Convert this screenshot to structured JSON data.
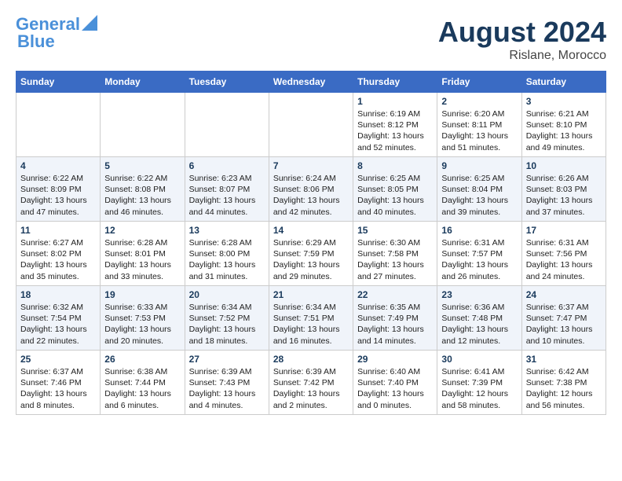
{
  "header": {
    "logo_line1": "General",
    "logo_line2": "Blue",
    "main_title": "August 2024",
    "subtitle": "Rislane, Morocco"
  },
  "calendar": {
    "days_of_week": [
      "Sunday",
      "Monday",
      "Tuesday",
      "Wednesday",
      "Thursday",
      "Friday",
      "Saturday"
    ],
    "weeks": [
      [
        {
          "day": "",
          "content": ""
        },
        {
          "day": "",
          "content": ""
        },
        {
          "day": "",
          "content": ""
        },
        {
          "day": "",
          "content": ""
        },
        {
          "day": "1",
          "content": "Sunrise: 6:19 AM\nSunset: 8:12 PM\nDaylight: 13 hours\nand 52 minutes."
        },
        {
          "day": "2",
          "content": "Sunrise: 6:20 AM\nSunset: 8:11 PM\nDaylight: 13 hours\nand 51 minutes."
        },
        {
          "day": "3",
          "content": "Sunrise: 6:21 AM\nSunset: 8:10 PM\nDaylight: 13 hours\nand 49 minutes."
        }
      ],
      [
        {
          "day": "4",
          "content": "Sunrise: 6:22 AM\nSunset: 8:09 PM\nDaylight: 13 hours\nand 47 minutes."
        },
        {
          "day": "5",
          "content": "Sunrise: 6:22 AM\nSunset: 8:08 PM\nDaylight: 13 hours\nand 46 minutes."
        },
        {
          "day": "6",
          "content": "Sunrise: 6:23 AM\nSunset: 8:07 PM\nDaylight: 13 hours\nand 44 minutes."
        },
        {
          "day": "7",
          "content": "Sunrise: 6:24 AM\nSunset: 8:06 PM\nDaylight: 13 hours\nand 42 minutes."
        },
        {
          "day": "8",
          "content": "Sunrise: 6:25 AM\nSunset: 8:05 PM\nDaylight: 13 hours\nand 40 minutes."
        },
        {
          "day": "9",
          "content": "Sunrise: 6:25 AM\nSunset: 8:04 PM\nDaylight: 13 hours\nand 39 minutes."
        },
        {
          "day": "10",
          "content": "Sunrise: 6:26 AM\nSunset: 8:03 PM\nDaylight: 13 hours\nand 37 minutes."
        }
      ],
      [
        {
          "day": "11",
          "content": "Sunrise: 6:27 AM\nSunset: 8:02 PM\nDaylight: 13 hours\nand 35 minutes."
        },
        {
          "day": "12",
          "content": "Sunrise: 6:28 AM\nSunset: 8:01 PM\nDaylight: 13 hours\nand 33 minutes."
        },
        {
          "day": "13",
          "content": "Sunrise: 6:28 AM\nSunset: 8:00 PM\nDaylight: 13 hours\nand 31 minutes."
        },
        {
          "day": "14",
          "content": "Sunrise: 6:29 AM\nSunset: 7:59 PM\nDaylight: 13 hours\nand 29 minutes."
        },
        {
          "day": "15",
          "content": "Sunrise: 6:30 AM\nSunset: 7:58 PM\nDaylight: 13 hours\nand 27 minutes."
        },
        {
          "day": "16",
          "content": "Sunrise: 6:31 AM\nSunset: 7:57 PM\nDaylight: 13 hours\nand 26 minutes."
        },
        {
          "day": "17",
          "content": "Sunrise: 6:31 AM\nSunset: 7:56 PM\nDaylight: 13 hours\nand 24 minutes."
        }
      ],
      [
        {
          "day": "18",
          "content": "Sunrise: 6:32 AM\nSunset: 7:54 PM\nDaylight: 13 hours\nand 22 minutes."
        },
        {
          "day": "19",
          "content": "Sunrise: 6:33 AM\nSunset: 7:53 PM\nDaylight: 13 hours\nand 20 minutes."
        },
        {
          "day": "20",
          "content": "Sunrise: 6:34 AM\nSunset: 7:52 PM\nDaylight: 13 hours\nand 18 minutes."
        },
        {
          "day": "21",
          "content": "Sunrise: 6:34 AM\nSunset: 7:51 PM\nDaylight: 13 hours\nand 16 minutes."
        },
        {
          "day": "22",
          "content": "Sunrise: 6:35 AM\nSunset: 7:49 PM\nDaylight: 13 hours\nand 14 minutes."
        },
        {
          "day": "23",
          "content": "Sunrise: 6:36 AM\nSunset: 7:48 PM\nDaylight: 13 hours\nand 12 minutes."
        },
        {
          "day": "24",
          "content": "Sunrise: 6:37 AM\nSunset: 7:47 PM\nDaylight: 13 hours\nand 10 minutes."
        }
      ],
      [
        {
          "day": "25",
          "content": "Sunrise: 6:37 AM\nSunset: 7:46 PM\nDaylight: 13 hours\nand 8 minutes."
        },
        {
          "day": "26",
          "content": "Sunrise: 6:38 AM\nSunset: 7:44 PM\nDaylight: 13 hours\nand 6 minutes."
        },
        {
          "day": "27",
          "content": "Sunrise: 6:39 AM\nSunset: 7:43 PM\nDaylight: 13 hours\nand 4 minutes."
        },
        {
          "day": "28",
          "content": "Sunrise: 6:39 AM\nSunset: 7:42 PM\nDaylight: 13 hours\nand 2 minutes."
        },
        {
          "day": "29",
          "content": "Sunrise: 6:40 AM\nSunset: 7:40 PM\nDaylight: 13 hours\nand 0 minutes."
        },
        {
          "day": "30",
          "content": "Sunrise: 6:41 AM\nSunset: 7:39 PM\nDaylight: 12 hours\nand 58 minutes."
        },
        {
          "day": "31",
          "content": "Sunrise: 6:42 AM\nSunset: 7:38 PM\nDaylight: 12 hours\nand 56 minutes."
        }
      ]
    ]
  }
}
